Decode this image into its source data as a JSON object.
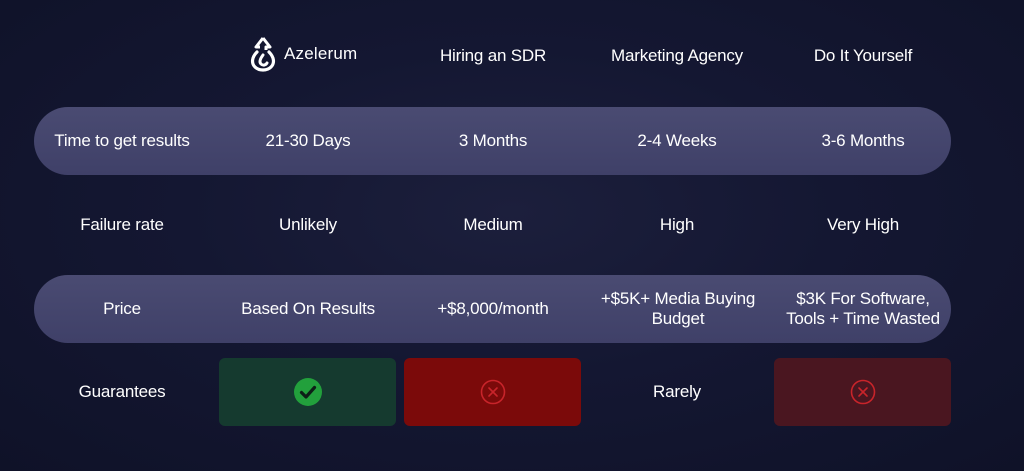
{
  "brand": {
    "name": "Azelerum",
    "logo_icon": "azelerum-drop-arrow-icon"
  },
  "headers": {
    "col2": "Hiring an SDR",
    "col3": "Marketing Agency",
    "col4": "Do It Yourself"
  },
  "rows": {
    "time": {
      "label": "Time to get results",
      "azelerum": "21-30 Days",
      "sdr": "3 Months",
      "agency": "2-4 Weeks",
      "diy": "3-6 Months"
    },
    "failure": {
      "label": "Failure rate",
      "azelerum": "Unlikely",
      "sdr": "Medium",
      "agency": "High",
      "diy": "Very High"
    },
    "price": {
      "label": "Price",
      "azelerum": "Based On Results",
      "sdr": "+$8,000/month",
      "agency_line1": "+$5K+ Media Buying",
      "agency_line2": "Budget",
      "diy_line1": "$3K For Software,",
      "diy_line2": "Tools + Time Wasted"
    },
    "guarantees": {
      "label": "Guarantees",
      "azelerum_icon": "check-circle-icon",
      "sdr_icon": "x-circle-icon",
      "agency": "Rarely",
      "diy_icon": "x-circle-icon"
    }
  },
  "colors": {
    "band": "#4a4b72",
    "green_box": "#153a2f",
    "check_green": "#22a03c",
    "red_box": "#7b0a0a",
    "red_box_faded": "#4a1620",
    "x_red": "#d12a2a"
  }
}
